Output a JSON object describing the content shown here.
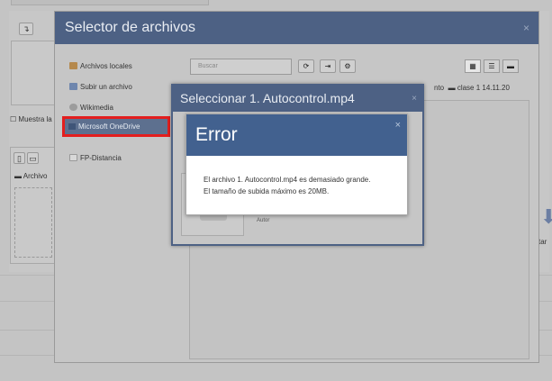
{
  "background": {
    "button_glyph": "↴",
    "show_checkbox_label": "Muestra la",
    "folder_label": "Archivo",
    "upload_partial_label": "tar"
  },
  "file_picker": {
    "title": "Selector de archivos",
    "close_glyph": "×",
    "repositories": [
      {
        "label": "Archivos locales",
        "icon": "local-files-icon"
      },
      {
        "label": "Subir un archivo",
        "icon": "upload-icon"
      },
      {
        "label": "Wikimedia",
        "icon": "wikimedia-icon"
      },
      {
        "label": "Microsoft OneDrive",
        "icon": "onedrive-icon",
        "active": true
      },
      {
        "label": "FP-Distancia",
        "icon": "fp-distancia-icon"
      }
    ],
    "search_placeholder": "Buscar",
    "toolbar": {
      "refresh": "⟳",
      "logout": "⇥",
      "settings": "⚙"
    },
    "views": {
      "icons": "▦",
      "list": "☰",
      "tree": "▬"
    },
    "breadcrumb": {
      "prefix": "nto",
      "folder": "clase 1 14.11.20"
    }
  },
  "select_dialog": {
    "title": "Seleccionar 1. Autocontrol.mp4",
    "close_glyph": "×",
    "author_label": "Autor"
  },
  "error_dialog": {
    "title": "Error",
    "close_glyph": "×",
    "message_line1": "El archivo 1. Autocontrol.mp4 es demasiado grande.",
    "message_line2": "El tamaño de subida máximo es 20MB."
  },
  "colors": {
    "header_blue": "#4d6184",
    "error_header_blue": "#42618f",
    "highlight_red": "#e31e1e"
  }
}
